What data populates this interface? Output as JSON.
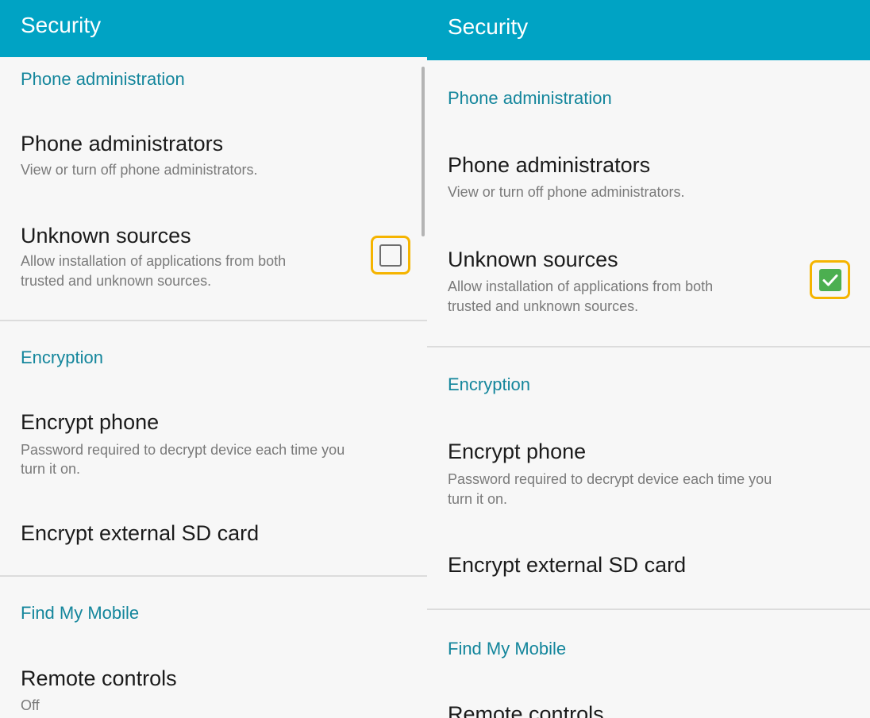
{
  "left": {
    "title": "Security",
    "sections": {
      "phone_admin": "Phone administration",
      "encryption": "Encryption",
      "find_my_mobile": "Find My Mobile"
    },
    "items": {
      "phone_administrators": {
        "title": "Phone administrators",
        "summary": "View or turn off phone administrators."
      },
      "unknown_sources": {
        "title": "Unknown sources",
        "summary_line1": "Allow installation of applications from both",
        "summary_line2": "trusted and unknown sources.",
        "checked": false
      },
      "encrypt_phone": {
        "title": "Encrypt phone",
        "summary_line1": "Password required to decrypt device each time you",
        "summary_line2": "turn it on."
      },
      "encrypt_sd": {
        "title": "Encrypt external SD card"
      },
      "remote_controls": {
        "title": "Remote controls",
        "summary": "Off"
      }
    }
  },
  "right": {
    "title": "Security",
    "sections": {
      "phone_admin": "Phone administration",
      "encryption": "Encryption",
      "find_my_mobile": "Find My Mobile"
    },
    "items": {
      "phone_administrators": {
        "title": "Phone administrators",
        "summary": "View or turn off phone administrators."
      },
      "unknown_sources": {
        "title": "Unknown sources",
        "summary_line1": "Allow installation of applications from both",
        "summary_line2": "trusted and unknown sources.",
        "checked": true
      },
      "encrypt_phone": {
        "title": "Encrypt phone",
        "summary_line1": "Password required to decrypt device each time you",
        "summary_line2": "turn it on."
      },
      "encrypt_sd": {
        "title": "Encrypt external SD card"
      },
      "remote_controls": {
        "title": "Remote controls"
      }
    }
  },
  "colors": {
    "header": "#00a3c4",
    "category_text": "#14869c",
    "highlight": "#f5b400",
    "checkbox_checked": "#4caf50"
  },
  "icons": {
    "checked": "check-icon"
  }
}
